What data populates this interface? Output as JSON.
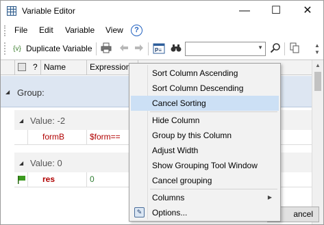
{
  "window": {
    "title": "Variable Editor",
    "controls": {
      "minimize": "—",
      "maximize": "☐",
      "close": "✕"
    }
  },
  "menu": {
    "items": [
      {
        "label": "File"
      },
      {
        "label": "Edit"
      },
      {
        "label": "Variable"
      },
      {
        "label": "View"
      }
    ],
    "help_glyph": "?"
  },
  "toolbar": {
    "duplicate_label": "Duplicate Variable",
    "duplicate_icon": "{v}",
    "search_value": ""
  },
  "grid": {
    "headers": {
      "flag": "",
      "question": "?",
      "name": "Name",
      "expression": "Expression"
    },
    "group_label": "Group:",
    "subgroups": [
      {
        "label": "Value: -2",
        "rows": [
          {
            "name": "formB",
            "expression": "$form=="
          }
        ]
      },
      {
        "label": "Value: 0",
        "rows": [
          {
            "name": "res",
            "expression": "0"
          }
        ]
      }
    ],
    "cancel_button": "ancel"
  },
  "context_menu": {
    "items": [
      {
        "label": "Sort Column Ascending"
      },
      {
        "label": "Sort Column Descending"
      },
      {
        "label": "Cancel Sorting"
      },
      {
        "label": "Hide Column"
      },
      {
        "label": "Group by this Column"
      },
      {
        "label": "Adjust Width"
      },
      {
        "label": "Show Grouping Tool Window"
      },
      {
        "label": "Cancel grouping"
      },
      {
        "label": "Columns"
      },
      {
        "label": "Options..."
      }
    ],
    "highlighted": "Cancel Sorting"
  },
  "colors": {
    "accent": "#cce0f5",
    "group_band": "#dde6f2",
    "name_red": "#b00000",
    "expr_green": "#2e7d32",
    "flag_green": "#3c9a1f"
  }
}
